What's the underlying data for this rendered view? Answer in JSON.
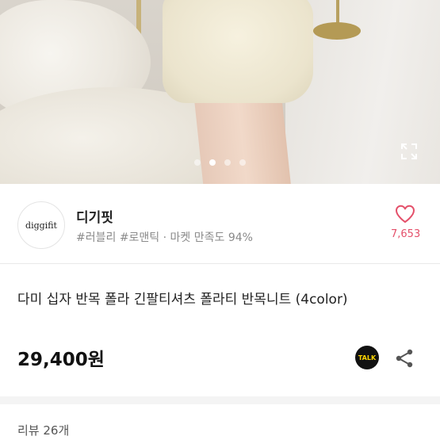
{
  "gallery": {
    "dot_count": 4,
    "active_index": 1
  },
  "shop": {
    "logo_text": "diggifit",
    "name": "디기핏",
    "tags": "#러블리 #로맨틱 · 마켓 만족도 94%",
    "like_count": "7,653"
  },
  "product": {
    "title": "다미 십자 반목 폴라 긴팔티셔츠 폴라티 반목니트 (4color)",
    "price": "29,400원",
    "talk_label": "TALK"
  },
  "review": {
    "label": "리뷰 26개"
  },
  "colors": {
    "like_accent": "#e4506a",
    "talk_bg": "#111111",
    "talk_text": "#ffd600"
  }
}
